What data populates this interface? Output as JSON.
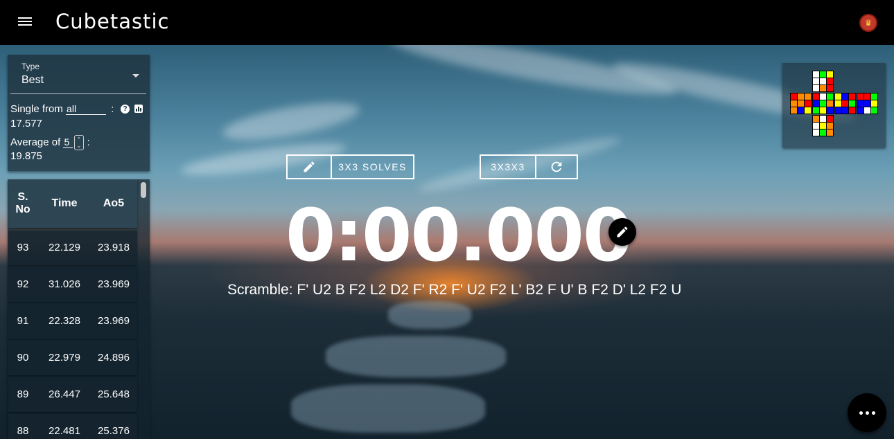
{
  "app": {
    "title": "Cubetastic"
  },
  "stats": {
    "type_label": "Type",
    "type_value": "Best",
    "single_prefix": "Single from",
    "single_range": "all",
    "single_colon": ":",
    "single_value": "17.577",
    "average_prefix": "Average of",
    "average_count": "5",
    "average_colon": ":",
    "average_value": "19.875"
  },
  "table": {
    "headers": [
      "S. No",
      "Time",
      "Ao5"
    ],
    "header_sno_line1": "S.",
    "header_sno_line2": "No",
    "rows": [
      {
        "no": "93",
        "time": "22.129",
        "ao5": "23.918"
      },
      {
        "no": "92",
        "time": "31.026",
        "ao5": "23.969"
      },
      {
        "no": "91",
        "time": "22.328",
        "ao5": "23.969"
      },
      {
        "no": "90",
        "time": "22.979",
        "ao5": "24.896"
      },
      {
        "no": "89",
        "time": "26.447",
        "ao5": "25.648"
      },
      {
        "no": "88",
        "time": "22.481",
        "ao5": "25.376"
      }
    ]
  },
  "session": {
    "label": "3X3 SOLVES"
  },
  "puzzle": {
    "label": "3X3X3"
  },
  "timer": {
    "value": "0:00.000"
  },
  "scramble": {
    "text": "Scramble: F' U2 B F2 L2 D2 F' R2 F' U2 F2 L' B2 F U' B F2 D' L2 F2 U"
  },
  "colors": {
    "appbar": "#000000",
    "W": "#ffffff",
    "Y": "#ffff00",
    "R": "#ff0000",
    "O": "#ff8c00",
    "G": "#00ff00",
    "B": "#0000ff"
  },
  "cube": {
    "U": [
      "W",
      "G",
      "Y",
      "W",
      "W",
      "R",
      "W",
      "O",
      "R"
    ],
    "L": [
      "R",
      "O",
      "O",
      "O",
      "O",
      "R",
      "O",
      "B",
      "Y"
    ],
    "F": [
      "R",
      "W",
      "G",
      "B",
      "G",
      "O",
      "G",
      "Y",
      "B"
    ],
    "R": [
      "Y",
      "B",
      "R",
      "Y",
      "R",
      "G",
      "B",
      "B",
      "R"
    ],
    "B": [
      "R",
      "R",
      "G",
      "B",
      "B",
      "Y",
      "B",
      "W",
      "G"
    ],
    "D": [
      "O",
      "W",
      "R",
      "W",
      "Y",
      "O",
      "W",
      "G",
      "O"
    ]
  }
}
